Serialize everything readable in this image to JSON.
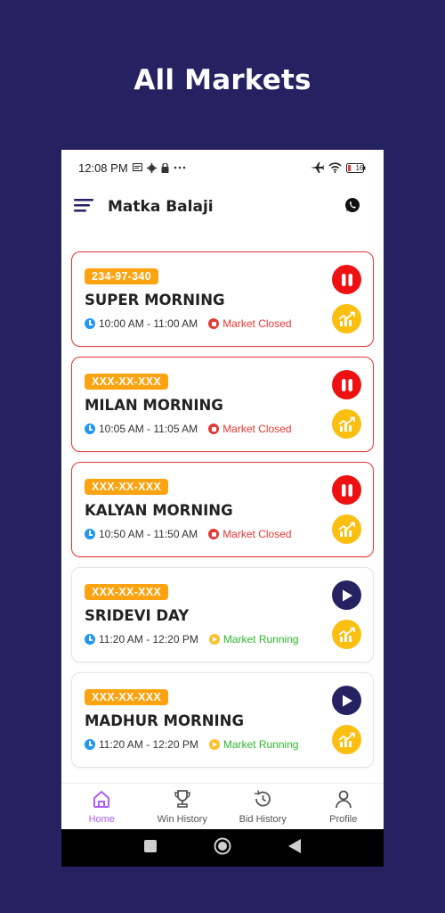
{
  "promo": {
    "title": "All Markets"
  },
  "status_bar": {
    "time": "12:08 PM",
    "battery": "16"
  },
  "app_bar": {
    "title": "Matka Balaji"
  },
  "markets": [
    {
      "result": "234-97-340",
      "name": "SUPER MORNING",
      "time": "10:00 AM - 11:00 AM",
      "status": "Market Closed",
      "state": "closed"
    },
    {
      "result": "XXX-XX-XXX",
      "name": "MILAN MORNING",
      "time": "10:05 AM - 11:05 AM",
      "status": "Market Closed",
      "state": "closed"
    },
    {
      "result": "XXX-XX-XXX",
      "name": "KALYAN MORNING",
      "time": "10:50 AM - 11:50 AM",
      "status": "Market Closed",
      "state": "closed"
    },
    {
      "result": "XXX-XX-XXX",
      "name": "SRIDEVI DAY",
      "time": "11:20 AM - 12:20 PM",
      "status": "Market Running",
      "state": "running"
    },
    {
      "result": "XXX-XX-XXX",
      "name": "MADHUR MORNING",
      "time": "11:20 AM - 12:20 PM",
      "status": "Market Running",
      "state": "running"
    }
  ],
  "bottom_nav": [
    {
      "label": "Home",
      "icon": "home-icon",
      "active": true
    },
    {
      "label": "Win History",
      "icon": "trophy-icon",
      "active": false
    },
    {
      "label": "Bid History",
      "icon": "history-icon",
      "active": false
    },
    {
      "label": "Profile",
      "icon": "user-icon",
      "active": false
    }
  ],
  "colors": {
    "background": "#262261",
    "badge": "#fca311",
    "closed": "#e53935",
    "running": "#2eb82e",
    "accent": "#b05cf5",
    "chart_button": "#fbbf12"
  }
}
